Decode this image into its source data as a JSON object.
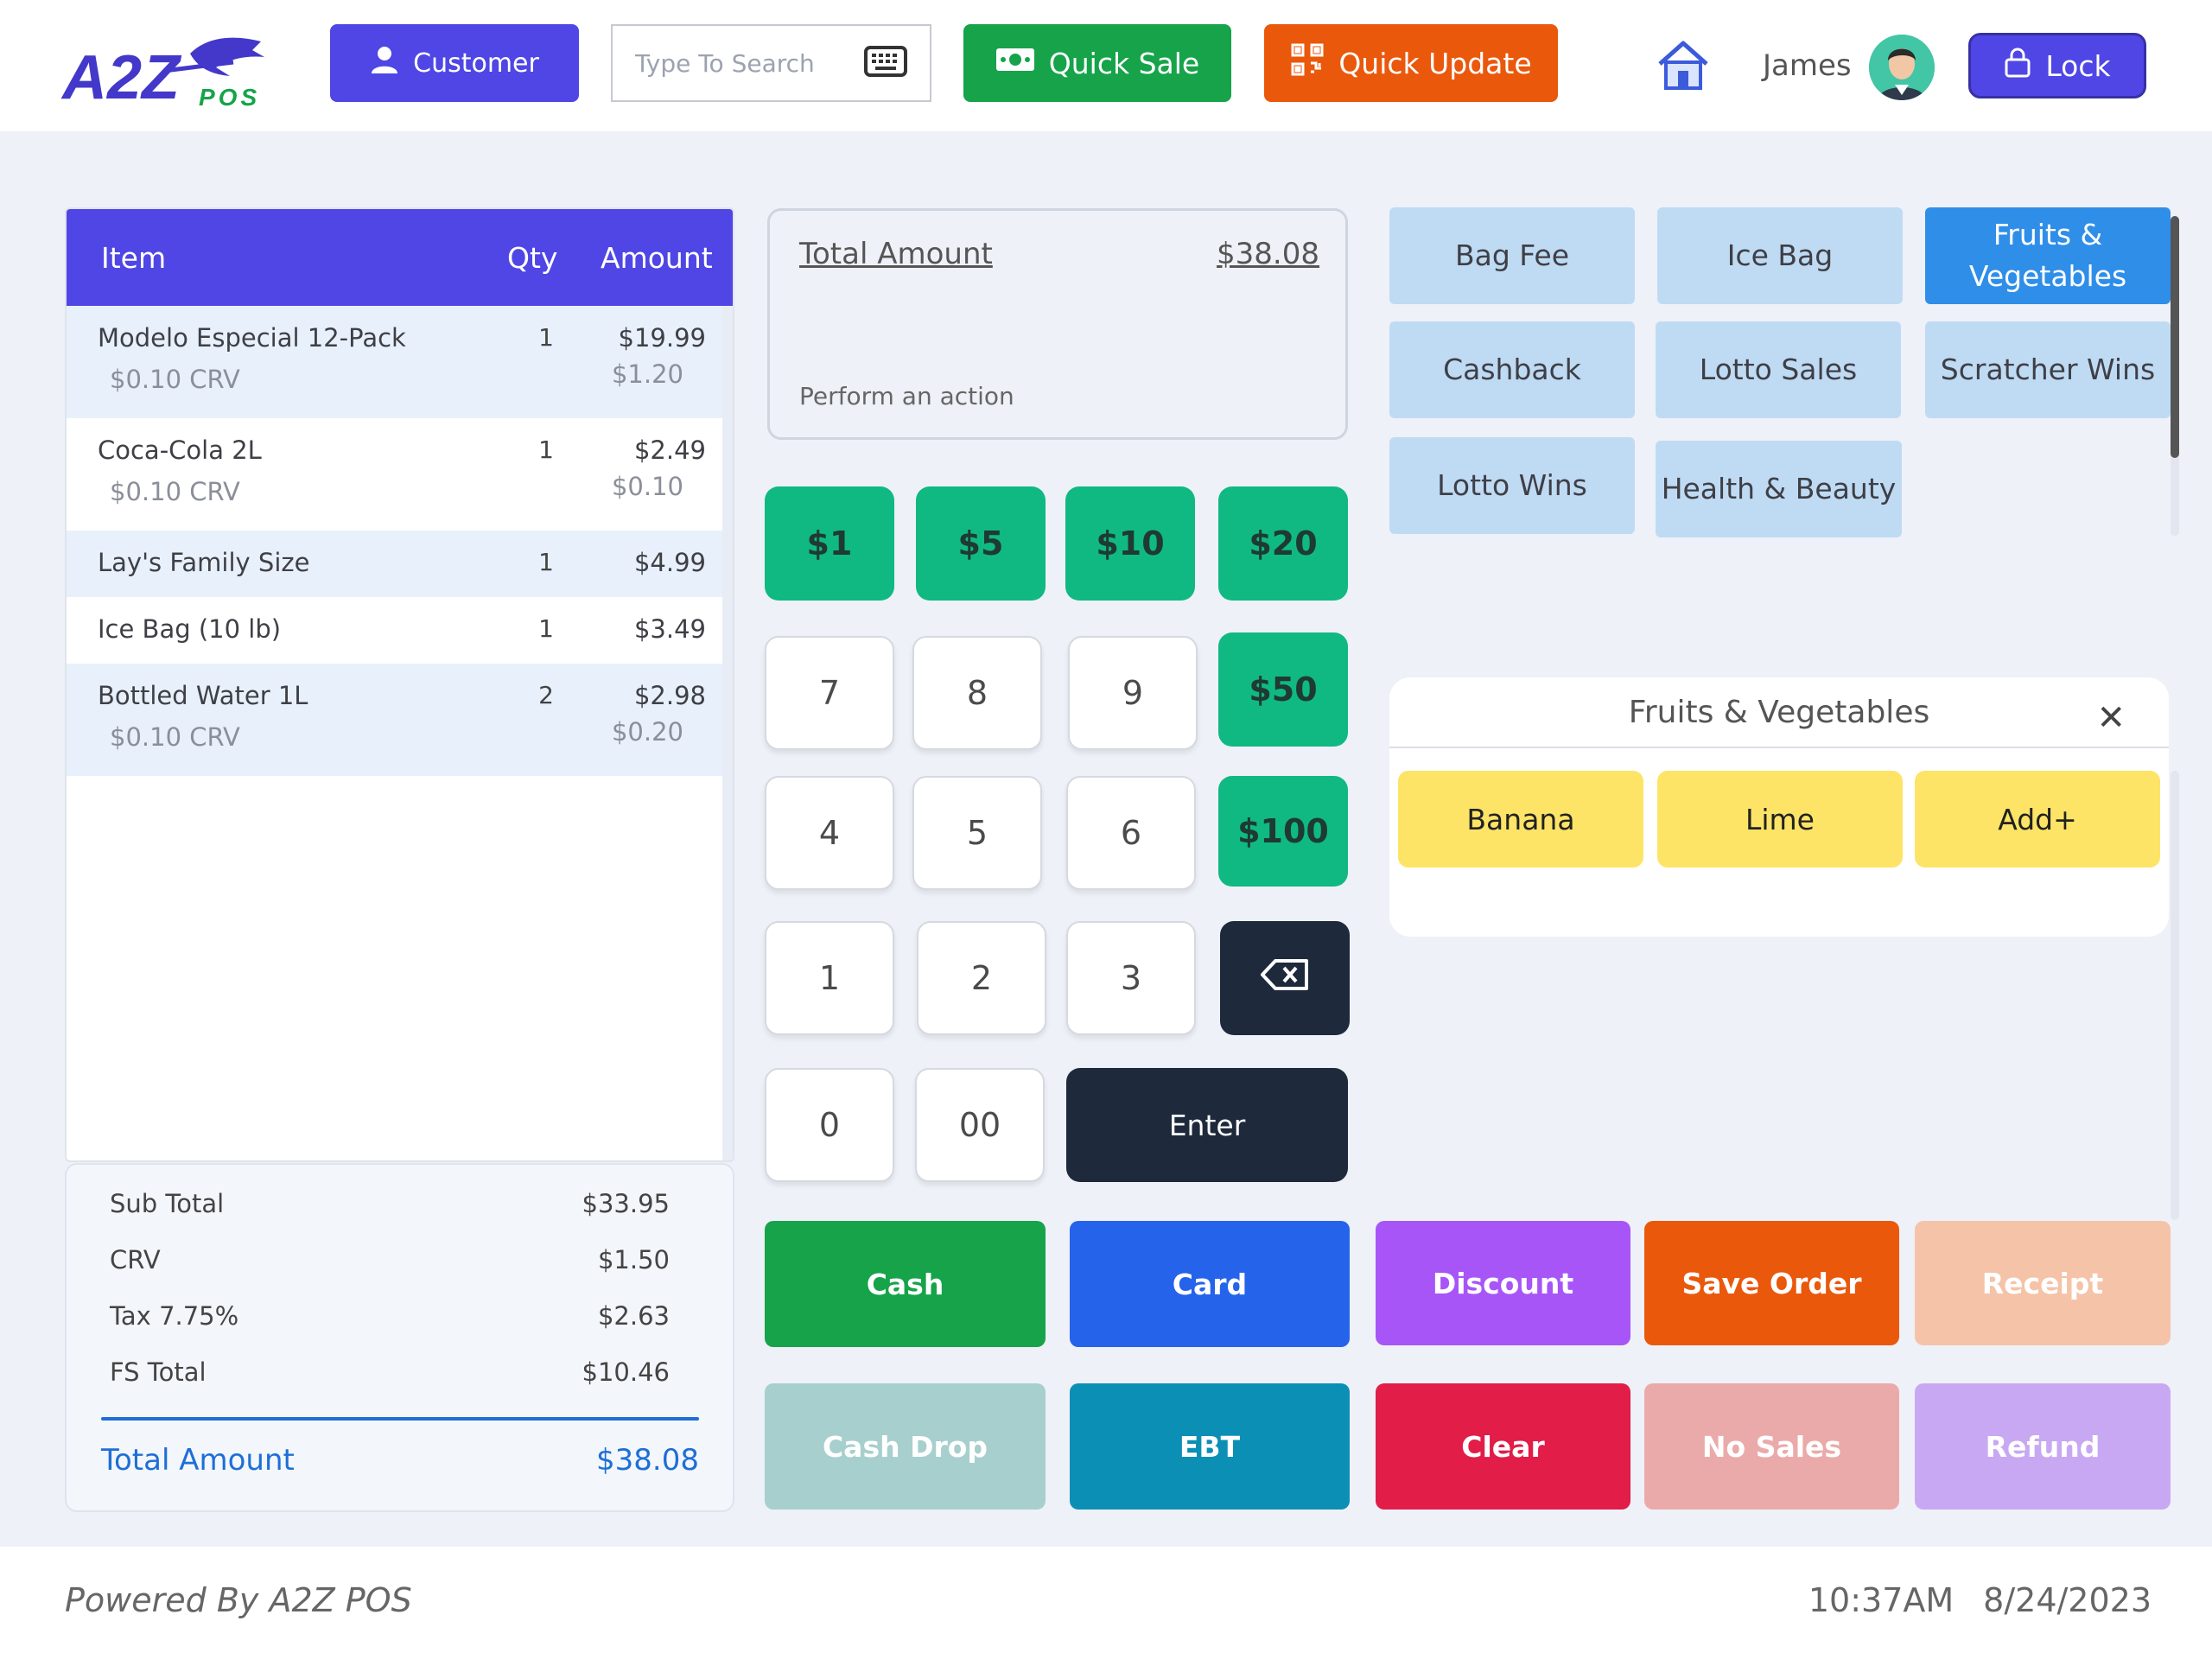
{
  "header": {
    "logo_text": "A2Z",
    "logo_sub": "POS",
    "customer_label": "Customer",
    "search_placeholder": "Type To Search",
    "quick_sale_label": "Quick Sale",
    "quick_update_label": "Quick Update",
    "user_name": "James",
    "lock_label": "Lock"
  },
  "cart": {
    "columns": {
      "item": "Item",
      "qty": "Qty",
      "amount": "Amount"
    },
    "items": [
      {
        "name": "Modelo Especial 12-Pack",
        "qty": "1",
        "amount": "$19.99",
        "sub_label": "$0.10 CRV",
        "sub_amount": "$1.20"
      },
      {
        "name": "Coca-Cola 2L",
        "qty": "1",
        "amount": "$2.49",
        "sub_label": "$0.10 CRV",
        "sub_amount": "$0.10"
      },
      {
        "name": "Lay's Family Size",
        "qty": "1",
        "amount": "$4.99"
      },
      {
        "name": "Ice Bag (10 lb)",
        "qty": "1",
        "amount": "$3.49"
      },
      {
        "name": "Bottled Water 1L",
        "qty": "2",
        "amount": "$2.98",
        "sub_label": "$0.10 CRV",
        "sub_amount": "$0.20"
      }
    ]
  },
  "totals": {
    "sub_total_label": "Sub Total",
    "sub_total": "$33.95",
    "crv_label": "CRV",
    "crv": "$1.50",
    "tax_label": "Tax 7.75%",
    "tax": "$2.63",
    "fs_total_label": "FS Total",
    "fs_total": "$10.46",
    "grand_total_label": "Total Amount",
    "grand_total": "$38.08"
  },
  "display": {
    "label": "Total Amount",
    "value": "$38.08",
    "message": "Perform an action"
  },
  "keypad": {
    "cash_keys": [
      "$1",
      "$5",
      "$10",
      "$20",
      "$50",
      "$100"
    ],
    "digits": [
      "7",
      "8",
      "9",
      "4",
      "5",
      "6",
      "1",
      "2",
      "3",
      "0",
      "00"
    ],
    "enter_label": "Enter"
  },
  "categories": [
    "Bag Fee",
    "Ice Bag",
    "Fruits & Vegetables",
    "Cashback",
    "Lotto Sales",
    "Scratcher Wins",
    "Lotto Wins",
    "Health & Beauty"
  ],
  "active_category": "Fruits & Vegetables",
  "subcategory": {
    "title": "Fruits & Vegetables",
    "products": [
      "Banana",
      "Lime",
      "Add+"
    ]
  },
  "actions": {
    "cash": "Cash",
    "card": "Card",
    "discount": "Discount",
    "save_order": "Save Order",
    "receipt": "Receipt",
    "cash_drop": "Cash Drop",
    "ebt": "EBT",
    "clear": "Clear",
    "no_sales": "No Sales",
    "refund": "Refund"
  },
  "colors": {
    "primary": "#4f46e5",
    "success": "#16a34a",
    "accent_orange": "#ea580c",
    "link_blue": "#1d6fd6"
  },
  "footer": {
    "powered_by": "Powered By A2Z POS",
    "time": "10:37AM",
    "date": "8/24/2023"
  }
}
